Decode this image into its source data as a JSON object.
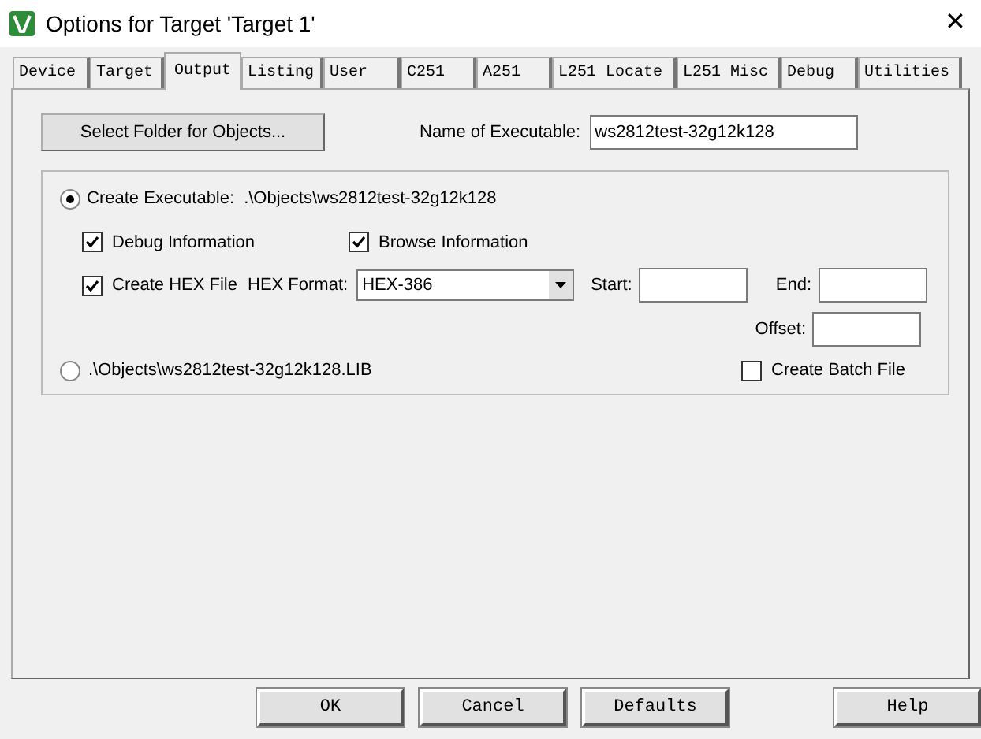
{
  "window": {
    "title": "Options for Target 'Target 1'",
    "close": "✕"
  },
  "tabs": [
    {
      "label": "Device",
      "selected": false
    },
    {
      "label": "Target",
      "selected": false
    },
    {
      "label": "Output",
      "selected": true
    },
    {
      "label": "Listing",
      "selected": false
    },
    {
      "label": "User",
      "selected": false
    },
    {
      "label": "C251",
      "selected": false
    },
    {
      "label": "A251",
      "selected": false
    },
    {
      "label": "L251 Locate",
      "selected": false
    },
    {
      "label": "L251 Misc",
      "selected": false
    },
    {
      "label": "Debug",
      "selected": false
    },
    {
      "label": "Utilities",
      "selected": false
    }
  ],
  "select_folder_button": "Select Folder for Objects...",
  "name_of_executable": {
    "label": "Name of Executable:",
    "value": "ws2812test-32g12k128"
  },
  "create_executable": {
    "label": "Create Executable:",
    "path": ".\\Objects\\ws2812test-32g12k128",
    "selected": true
  },
  "debug_information": {
    "label": "Debug Information",
    "checked": true
  },
  "browse_information": {
    "label": "Browse Information",
    "checked": true
  },
  "create_hex_file": {
    "label": "Create HEX File",
    "checked": true
  },
  "hex_format": {
    "label": "HEX Format:",
    "value": "HEX-386"
  },
  "start": {
    "label": "Start:"
  },
  "end": {
    "label": "End:"
  },
  "offset": {
    "label": "Offset:"
  },
  "create_library": {
    "label": ".\\Objects\\ws2812test-32g12k128.LIB",
    "selected": false
  },
  "create_batch_file": {
    "label": "Create Batch File",
    "checked": false
  },
  "buttons": [
    "OK",
    "Cancel",
    "Defaults",
    "Help"
  ]
}
